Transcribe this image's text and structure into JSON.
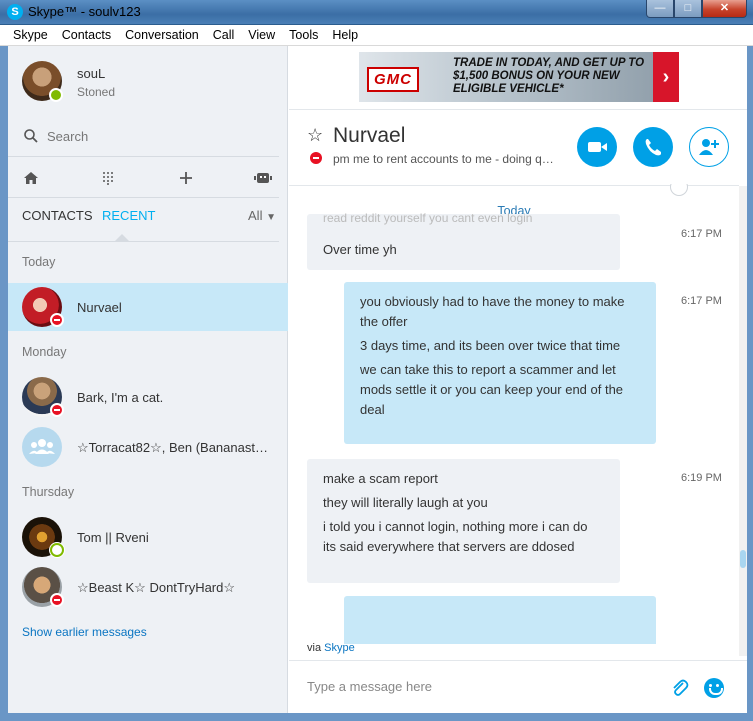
{
  "window": {
    "title": "Skype™ - soulv123",
    "app_icon": "S",
    "controls": {
      "minimize": "—",
      "maximize": "□",
      "close": "✕"
    }
  },
  "menu": [
    "Skype",
    "Contacts",
    "Conversation",
    "Call",
    "View",
    "Tools",
    "Help"
  ],
  "profile": {
    "name": "souL",
    "mood": "Stoned",
    "status": "online"
  },
  "search": {
    "label": "Search"
  },
  "tabs": {
    "contacts": "CONTACTS",
    "recent": "RECENT",
    "filter": "All"
  },
  "sections": {
    "today": "Today",
    "monday": "Monday",
    "thursday": "Thursday"
  },
  "contacts": [
    {
      "name": "Nurvael",
      "status": "busy",
      "selected": true
    },
    {
      "name": "Bark, I'm a cat.",
      "status": "busy"
    },
    {
      "name": "☆Torracat82☆, Ben (Bananastr…",
      "status": "group"
    },
    {
      "name": "Tom || Rveni",
      "status": "online"
    },
    {
      "name": "☆Beast K☆ DontTryHard☆",
      "status": "busy"
    }
  ],
  "show_earlier": "Show earlier messages",
  "ad": {
    "brand": "GMC",
    "text": "TRADE IN TODAY, AND GET UP TO $1,500 BONUS ON YOUR NEW ELIGIBLE VEHICLE*",
    "arrow": "›"
  },
  "chat": {
    "title": "Nurvael",
    "mood": "pm me to rent accounts to me - doing q…",
    "day": "Today",
    "ghost_text": "read reddit yourself you cant even login",
    "messages": [
      {
        "direction": "in",
        "lines": [
          "Over time yh"
        ],
        "time": "6:17 PM"
      },
      {
        "direction": "out",
        "lines": [
          "you obviously had to have the money to make the offer",
          "3 days time, and its been over twice that time",
          "we can take this to report a scammer and let mods settle it or you can keep your end of the deal"
        ],
        "time": "6:17 PM"
      },
      {
        "direction": "in",
        "lines": [
          "make a scam report",
          "they will literally laugh at you",
          "i told you i cannot login, nothing more i can do its said everywhere that servers are ddosed"
        ],
        "time": "6:19 PM"
      }
    ]
  },
  "via": {
    "prefix": "via",
    "link": "Skype"
  },
  "compose": {
    "placeholder": "Type a message here"
  },
  "colors": {
    "accent": "#00aff0",
    "selected": "#c7e8f8",
    "busy": "#e81123",
    "online": "#7fba00"
  }
}
